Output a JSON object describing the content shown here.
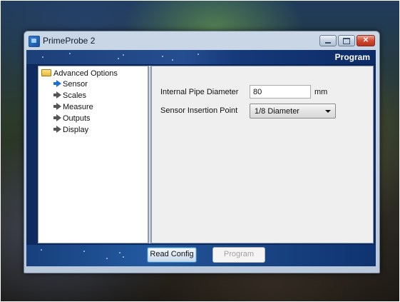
{
  "window": {
    "title": "PrimeProbe 2",
    "banner_title": "Program"
  },
  "tree": {
    "root": "Advanced Options",
    "items": [
      {
        "label": "Sensor",
        "selected": true
      },
      {
        "label": "Scales",
        "selected": false
      },
      {
        "label": "Measure",
        "selected": false
      },
      {
        "label": "Outputs",
        "selected": false
      },
      {
        "label": "Display",
        "selected": false
      }
    ]
  },
  "form": {
    "pipe_diameter_label": "Internal Pipe Diameter",
    "pipe_diameter_value": "80",
    "pipe_diameter_unit": "mm",
    "insertion_label": "Sensor Insertion Point",
    "insertion_value": "1/8 Diameter"
  },
  "buttons": {
    "read_config": "Read Config",
    "program": "Program"
  },
  "icons": {
    "app": "app-icon",
    "minimize": "minimize-icon",
    "maximize": "maximize-icon",
    "close": "close-icon",
    "folder": "folder-icon",
    "arrow": "arrow-right-icon"
  },
  "colors": {
    "banner": "#1d3f78",
    "selected_arrow": "#1e6fd6",
    "close_button": "#d04a31"
  }
}
